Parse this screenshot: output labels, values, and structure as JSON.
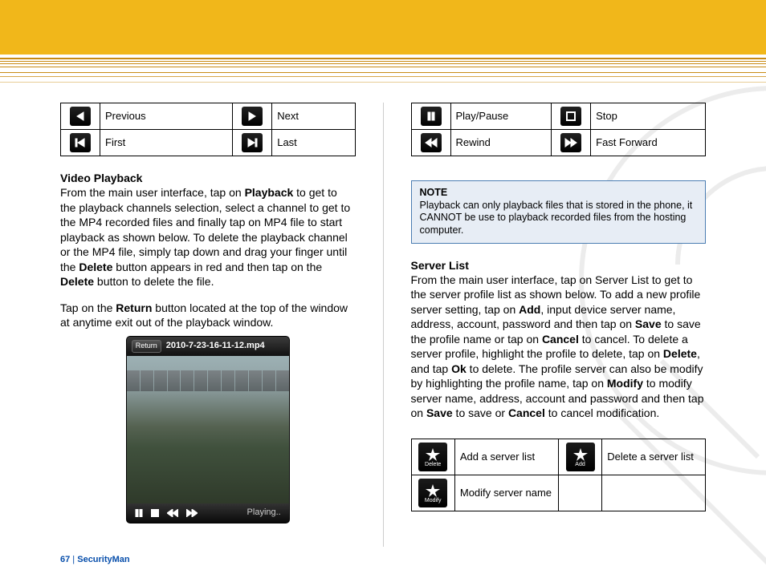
{
  "tables": {
    "nav": {
      "r1c1": "Previous",
      "r1c2": "Next",
      "r2c1": "First",
      "r2c2": "Last"
    },
    "play": {
      "r1c1": "Play/Pause",
      "r1c2": "Stop",
      "r2c1": "Rewind",
      "r2c2": "Fast Forward"
    },
    "server": {
      "r1c1": "Add a server list",
      "r1c2": "Delete a server list",
      "r2c1": "Modify server name",
      "i1": "Delete",
      "i2": "Add",
      "i3": "Modify"
    }
  },
  "left": {
    "title": "Video Playback",
    "p1a": "From the main user interface, tap on ",
    "p1b": "Playback",
    "p1c": " to get to the playback channels selection, select a channel to get to the MP4 recorded files and finally tap on MP4 file to start playback as shown below.  To delete the playback channel or the MP4 file, simply tap down and drag your finger until the ",
    "p1d": "Delete",
    "p1e": " button appears in red and then tap on the ",
    "p1f": "Delete",
    "p1g": " button to delete the file.",
    "p2a": "Tap on the ",
    "p2b": "Return",
    "p2c": " button located at the top of the window at anytime exit out of the playback window.",
    "phone": {
      "return": "Return",
      "filename": "2010-7-23-16-11-12.mp4",
      "status": "Playing.."
    }
  },
  "note": {
    "label": "NOTE",
    "text": "Playback can only playback files that is stored in the phone, it CANNOT be use to playback recorded files from the hosting computer."
  },
  "right": {
    "title": "Server List",
    "p1a": "From the main user interface, tap on Server List to get to the server profile list as shown below. To add a new profile server setting, tap on ",
    "p1b": "Add",
    "p1c": ", input device server name, address, account, password and then tap on ",
    "p1d": "Save",
    "p1e": " to save the profile name or tap on ",
    "p1f": "Cancel",
    "p1g": " to cancel.  To delete a server profile, highlight the profile to delete, tap on ",
    "p1h": "Delete",
    "p1i": ", and tap ",
    "p1j": "Ok",
    "p1k": " to delete.  The profile server can also be modify by highlighting the profile name, tap on ",
    "p1l": "Modify",
    "p1m": " to modify server name, address, account and password and then tap on ",
    "p1n": "Save",
    "p1o": " to save or ",
    "p1p": "Cancel",
    "p1q": " to cancel modification."
  },
  "footer": {
    "page": "67",
    "sep": "  |  ",
    "brand": "SecurityMan"
  }
}
